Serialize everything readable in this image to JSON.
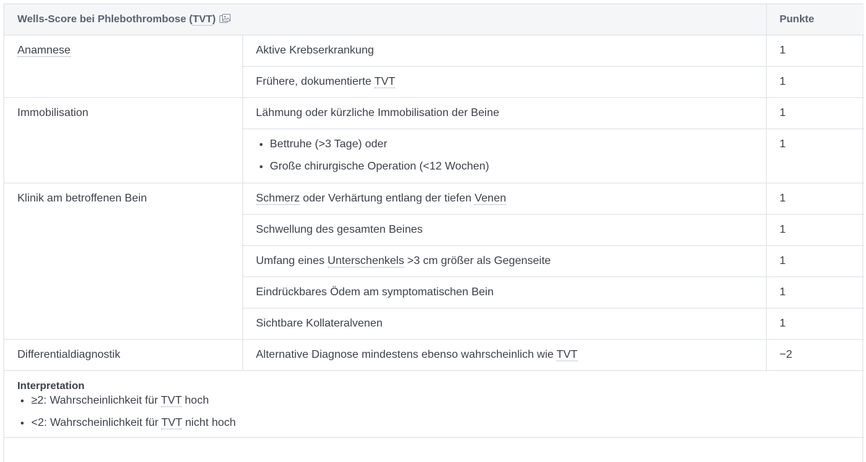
{
  "header": {
    "title_prefix": "Wells-Score bei Phlebothrombose (",
    "title_abbr": "TVT",
    "title_suffix": ")",
    "icon": "image-icon",
    "points_label": "Punkte"
  },
  "groups": {
    "anamnese": {
      "label": "Anamnese",
      "row1": {
        "text": "Aktive Krebserkrankung",
        "points": "1"
      },
      "row2": {
        "text_prefix": "Frühere, dokumentierte ",
        "abbr": "TVT",
        "points": "1"
      }
    },
    "immobilisation": {
      "label": "Immobilisation",
      "row1": {
        "text": "Lähmung oder kürzliche Immobilisation der Beine",
        "points": "1"
      },
      "row2": {
        "bullet1": "Bettruhe (>3 Tage) oder",
        "bullet2": "Große chirurgische Operation (<12 Wochen)",
        "points": "1"
      }
    },
    "klinik": {
      "label": "Klinik am betroffenen Bein",
      "row1": {
        "term1": "Schmerz",
        "middle": " oder Verhärtung entlang der tiefen ",
        "term2": "Venen",
        "points": "1"
      },
      "row2": {
        "text": "Schwellung des gesamten Beines",
        "points": "1"
      },
      "row3": {
        "prefix": "Umfang eines ",
        "term": "Unterschenkels",
        "suffix": " >3 cm größer als Gegenseite",
        "points": "1"
      },
      "row4": {
        "text": "Eindrückbares Ödem am symptomatischen Bein",
        "points": "1"
      },
      "row5": {
        "text": "Sichtbare Kollateralvenen",
        "points": "1"
      }
    },
    "differential": {
      "label": "Differentialdiagnostik",
      "row1": {
        "prefix": "Alternative Diagnose mindestens ebenso wahrscheinlich wie ",
        "abbr": "TVT",
        "points": "−2"
      }
    }
  },
  "interpretation": {
    "title": "Interpretation",
    "item1": {
      "prefix": "≥2: Wahrscheinlichkeit für ",
      "abbr": "TVT",
      "suffix": " hoch"
    },
    "item2": {
      "prefix": "<2: Wahrscheinlichkeit für ",
      "abbr": "TVT",
      "suffix": " nicht hoch"
    }
  }
}
